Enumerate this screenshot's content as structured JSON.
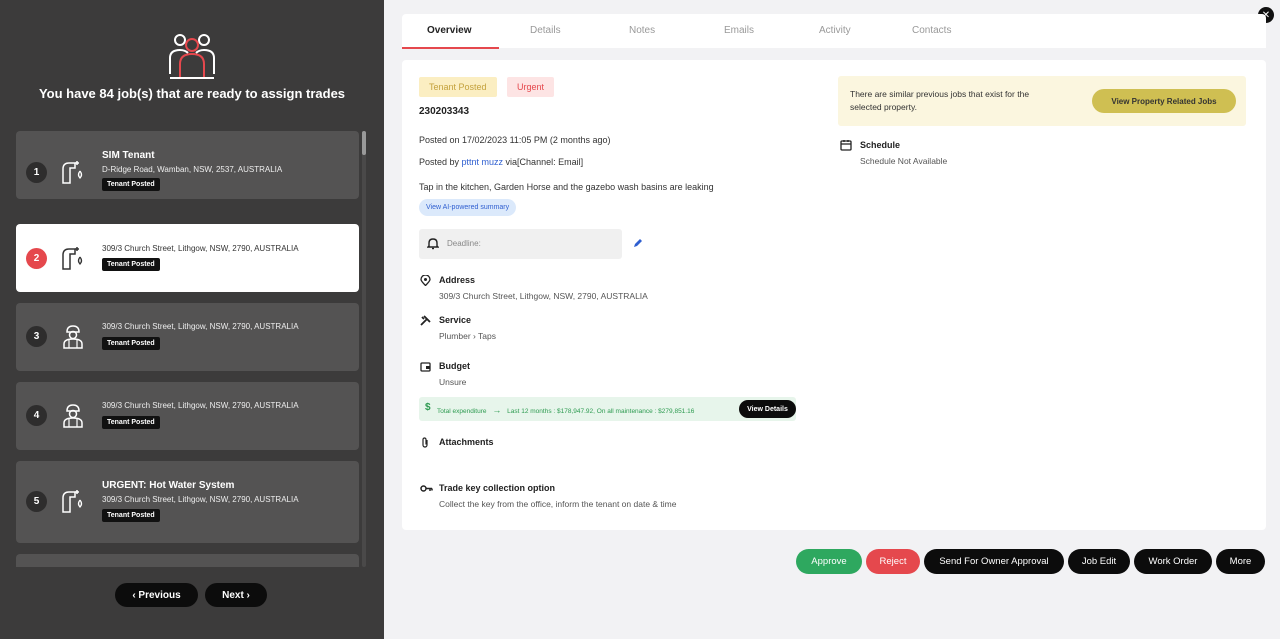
{
  "left": {
    "heading": "You have 84 job(s) that are ready to assign trades",
    "jobs": [
      {
        "num": "1",
        "title": "SIM Tenant",
        "address": "D-Ridge Road, Wamban, NSW, 2537, AUSTRALIA",
        "tag": "Tenant Posted",
        "icon": "tap-icon"
      },
      {
        "num": "2",
        "title": "",
        "address": "309/3 Church Street, Lithgow, NSW, 2790, AUSTRALIA",
        "tag": "Tenant Posted",
        "icon": "tap-icon"
      },
      {
        "num": "3",
        "title": "",
        "address": "309/3 Church Street, Lithgow, NSW, 2790, AUSTRALIA",
        "tag": "Tenant Posted",
        "icon": "worker-icon"
      },
      {
        "num": "4",
        "title": "",
        "address": "309/3 Church Street, Lithgow, NSW, 2790, AUSTRALIA",
        "tag": "Tenant Posted",
        "icon": "worker-icon"
      },
      {
        "num": "5",
        "title": "URGENT: Hot Water System",
        "address": "309/3 Church Street, Lithgow, NSW, 2790, AUSTRALIA",
        "tag": "Tenant Posted",
        "icon": "tap-icon"
      }
    ],
    "prev_label": "‹ Previous",
    "next_label": "Next ›"
  },
  "tabs": [
    "Overview",
    "Details",
    "Notes",
    "Emails",
    "Activity",
    "Contacts"
  ],
  "job": {
    "badges": {
      "status": "Tenant Posted",
      "priority": "Urgent"
    },
    "id": "230203343",
    "posted_on": "Posted on 17/02/2023 11:05 PM (2 months ago)",
    "posted_by_prefix": "Posted by ",
    "posted_by_user": "pttnt muzz",
    "posted_by_suffix": " via[Channel: Email]",
    "description": "Tap in the kitchen, Garden Horse and the gazebo wash basins are leaking",
    "ai_summary_label": "View AI-powered summary",
    "deadline_placeholder": "Deadline:",
    "address_title": "Address",
    "address_value": "309/3 Church Street, Lithgow, NSW, 2790, AUSTRALIA",
    "service_title": "Service",
    "service_value": "Plumber  ›  Taps",
    "budget_title": "Budget",
    "budget_value": "Unsure",
    "expenditure_label": "Total expenditure",
    "expenditure_detail": "Last 12 months : $178,947.92, On all maintenance : $279,851.16",
    "expenditure_button": "View Details",
    "attachments_title": "Attachments",
    "key_title": "Trade key collection option",
    "key_value": "Collect the key from the office, inform the tenant on date & time"
  },
  "similar": {
    "text": "There are similar previous jobs that exist for the selected property.",
    "button": "View Property Related Jobs"
  },
  "schedule": {
    "title": "Schedule",
    "value": "Schedule Not Available"
  },
  "actions": {
    "approve": "Approve",
    "reject": "Reject",
    "owner_approval": "Send For Owner Approval",
    "job_edit": "Job Edit",
    "work_order": "Work Order",
    "more": "More"
  },
  "colors": {
    "accent": "#e5484d",
    "approve": "#2ea85f",
    "reject": "#e5484d",
    "dark": "#0c0c0c"
  }
}
